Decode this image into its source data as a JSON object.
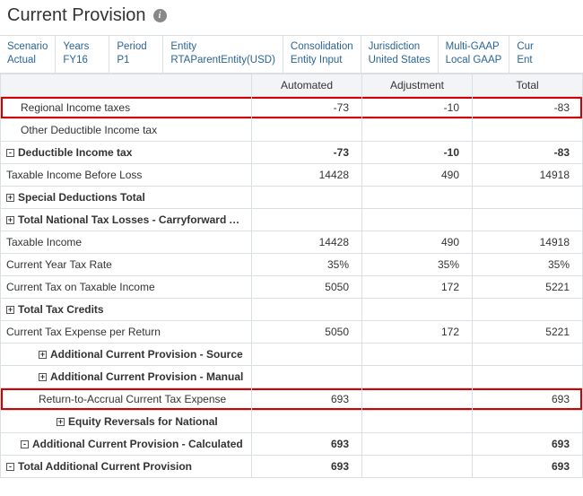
{
  "page": {
    "title": "Current Provision"
  },
  "pov": [
    {
      "label": "Scenario",
      "value": "Actual"
    },
    {
      "label": "Years",
      "value": "FY16"
    },
    {
      "label": "Period",
      "value": "P1"
    },
    {
      "label": "Entity",
      "value": "RTAParentEntity(USD)"
    },
    {
      "label": "Consolidation",
      "value": "Entity Input"
    },
    {
      "label": "Jurisdiction",
      "value": "United States"
    },
    {
      "label": "Multi-GAAP",
      "value": "Local GAAP"
    },
    {
      "label": "Cur",
      "value": "Ent"
    }
  ],
  "columns": [
    "Automated",
    "Adjustment",
    "Total"
  ],
  "rows": [
    {
      "label": "Regional Income taxes",
      "indent": 1,
      "exp": null,
      "automated": "-73",
      "adjustment": "-10",
      "total": "-83",
      "highlight": true
    },
    {
      "label": "Other Deductible Income tax",
      "indent": 1,
      "exp": null,
      "automated": "",
      "adjustment": "",
      "total": "",
      "editable_adj": true
    },
    {
      "label": "Deductible Income tax",
      "indent": 0,
      "exp": "-",
      "bold": true,
      "automated": "-73",
      "adjustment": "-10",
      "total": "-83"
    },
    {
      "label": "Taxable Income Before Loss",
      "indent": 0,
      "exp": null,
      "automated": "14428",
      "adjustment": "490",
      "total": "14918"
    },
    {
      "label": "Special Deductions Total",
      "indent": 0,
      "exp": "+",
      "bold": true,
      "automated": "",
      "adjustment": "",
      "total": ""
    },
    {
      "label": "Total National Tax Losses - Carryforward Automated",
      "indent": 0,
      "exp": "+",
      "bold": true,
      "automated": "",
      "adjustment": "",
      "total": ""
    },
    {
      "label": "Taxable Income",
      "indent": 0,
      "exp": null,
      "automated": "14428",
      "adjustment": "490",
      "total": "14918"
    },
    {
      "label": "Current Year Tax Rate",
      "indent": 0,
      "exp": null,
      "automated": "35%",
      "adjustment": "35%",
      "total": "35%"
    },
    {
      "label": "Current Tax on Taxable Income",
      "indent": 0,
      "exp": null,
      "automated": "5050",
      "adjustment": "172",
      "total": "5221"
    },
    {
      "label": "Total Tax Credits",
      "indent": 0,
      "exp": "+",
      "bold": true,
      "automated": "",
      "adjustment": "",
      "total": ""
    },
    {
      "label": "Current Tax Expense per Return",
      "indent": 0,
      "exp": null,
      "automated": "5050",
      "adjustment": "172",
      "total": "5221"
    },
    {
      "label": "Additional Current Provision - Source",
      "indent": 2,
      "exp": "+",
      "bold": true,
      "automated": "",
      "adjustment": "",
      "total": ""
    },
    {
      "label": "Additional Current Provision - Manual",
      "indent": 2,
      "exp": "+",
      "bold": true,
      "automated": "",
      "adjustment": "",
      "total": ""
    },
    {
      "label": "Return-to-Accrual Current Tax Expense",
      "indent": 2,
      "exp": null,
      "automated": "693",
      "adjustment": "",
      "total": "693",
      "highlight": true,
      "editable_adj": true
    },
    {
      "label": "Equity Reversals for National",
      "indent": 3,
      "exp": "+",
      "bold": true,
      "automated": "",
      "adjustment": "",
      "total": ""
    },
    {
      "label": "Additional Current Provision - Calculated",
      "indent": 1,
      "exp": "-",
      "bold": true,
      "automated": "693",
      "adjustment": "",
      "total": "693"
    },
    {
      "label": "Total Additional Current Provision",
      "indent": 0,
      "exp": "-",
      "bold": true,
      "automated": "693",
      "adjustment": "",
      "total": "693"
    }
  ]
}
